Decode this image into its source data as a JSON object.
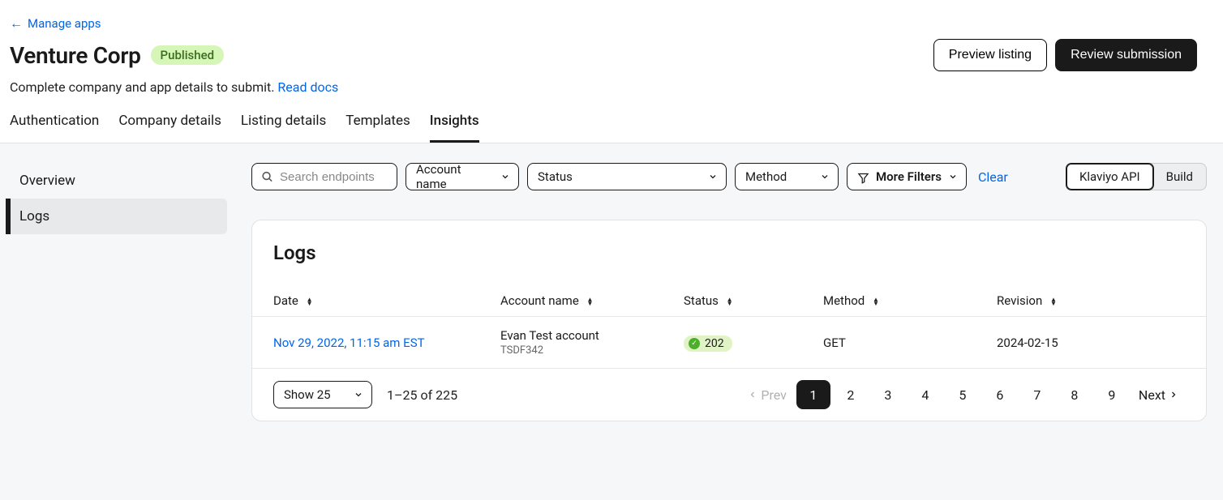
{
  "nav": {
    "back": "Manage apps"
  },
  "header": {
    "title": "Venture Corp",
    "status_badge": "Published",
    "subtitle_prefix": "Complete company and app details to submit. ",
    "subtitle_link": "Read docs",
    "actions": {
      "preview": "Preview listing",
      "review": "Review submission"
    }
  },
  "tabs": [
    "Authentication",
    "Company details",
    "Listing details",
    "Templates",
    "Insights"
  ],
  "tabs_active": 4,
  "sidebar": {
    "items": [
      "Overview",
      "Logs"
    ],
    "active": 1
  },
  "filters": {
    "search_placeholder": "Search endpoints",
    "account": "Account name",
    "status": "Status",
    "method": "Method",
    "more": "More Filters",
    "clear": "Clear"
  },
  "view_toggle": {
    "left": "Klaviyo API",
    "right": "Build",
    "active": "left"
  },
  "logs": {
    "title": "Logs",
    "columns": [
      "Date",
      "Account name",
      "Status",
      "Method",
      "Revision"
    ],
    "rows": [
      {
        "date": "Nov 29, 2022, 11:15 am EST",
        "account_name": "Evan Test account",
        "account_id": "TSDF342",
        "status_code": "202",
        "method": "GET",
        "revision": "2024-02-15"
      }
    ],
    "pagination": {
      "show_label": "Show 25",
      "range": "1–25 of 225",
      "prev": "Prev",
      "next": "Next",
      "pages": [
        "1",
        "2",
        "3",
        "4",
        "5",
        "6",
        "7",
        "8",
        "9"
      ],
      "active": "1"
    }
  }
}
